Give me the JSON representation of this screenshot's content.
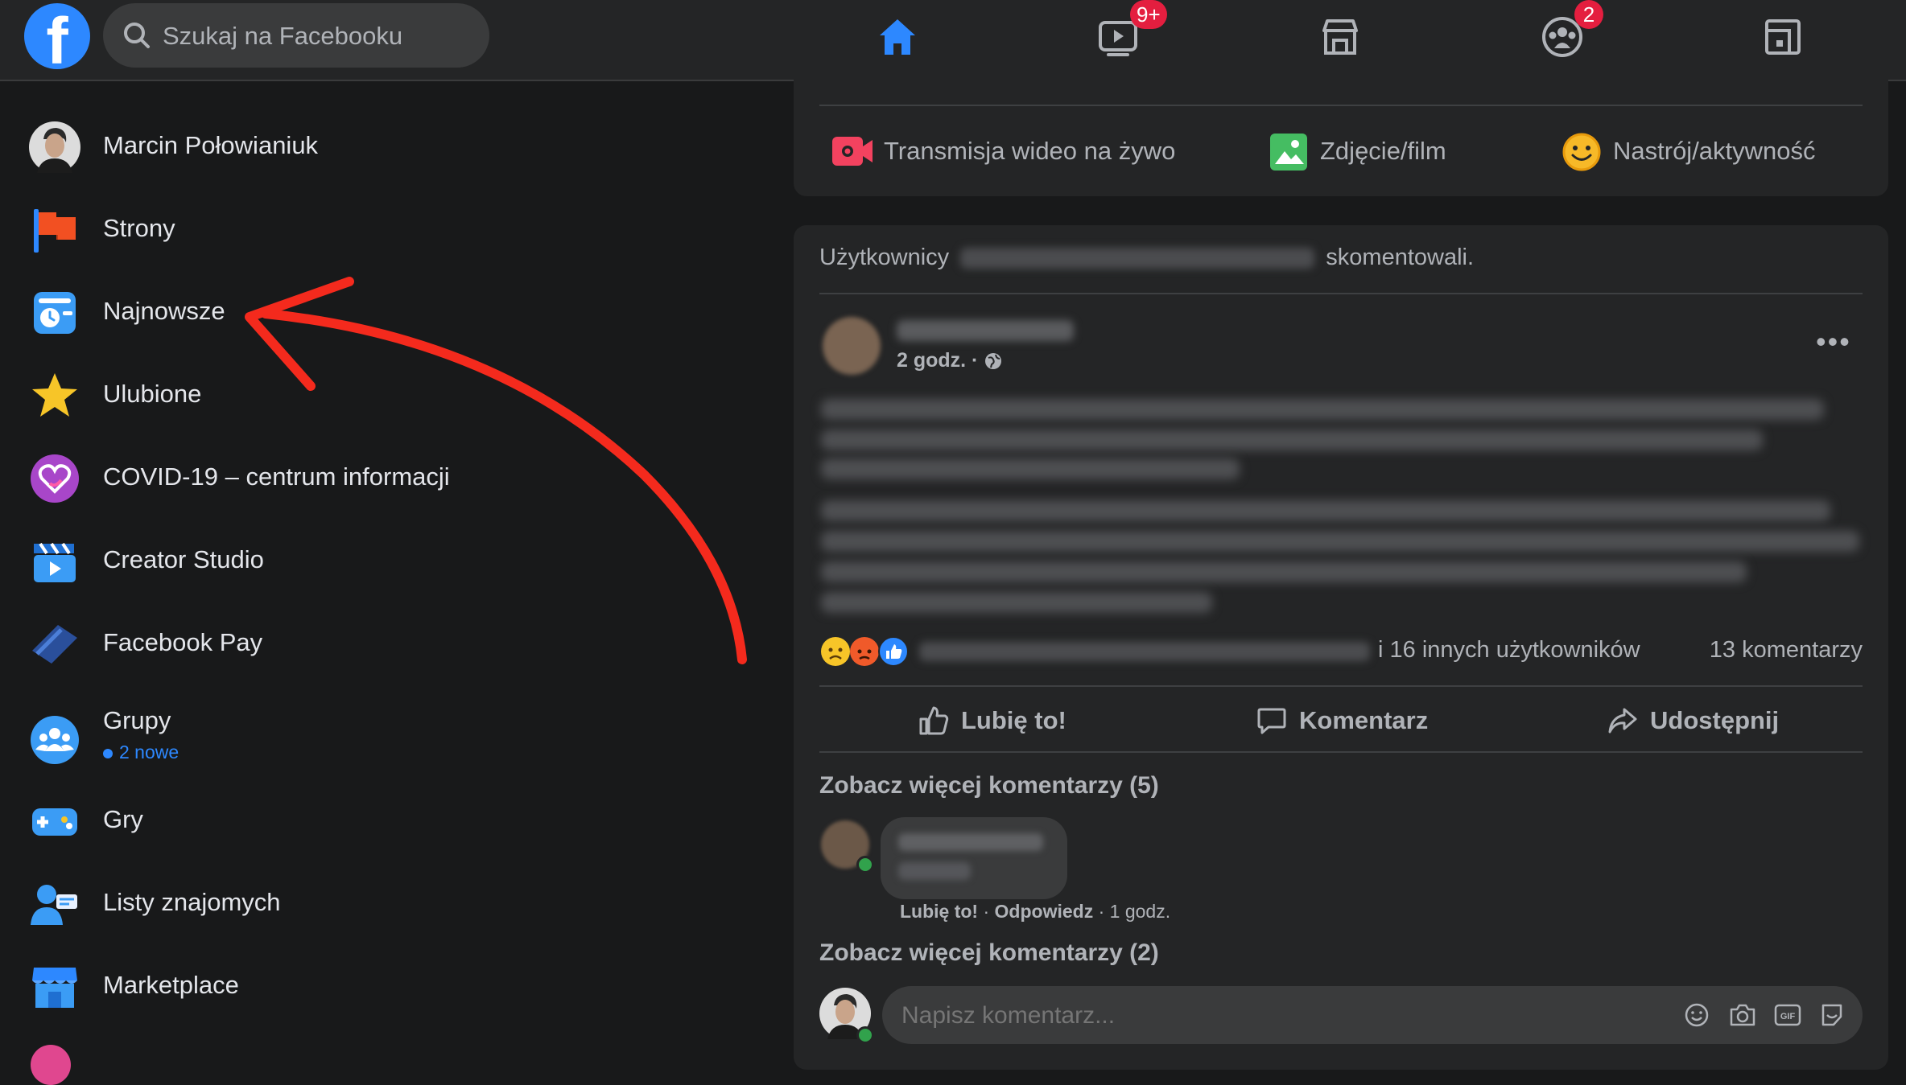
{
  "search": {
    "placeholder": "Szukaj na Facebooku"
  },
  "nav": {
    "home": {
      "icon": "home-icon"
    },
    "watch": {
      "icon": "video-icon",
      "badge": "9+"
    },
    "marketplace": {
      "icon": "marketplace-icon"
    },
    "groups": {
      "icon": "groups-icon",
      "badge": "2"
    },
    "gaming": {
      "icon": "gaming-icon"
    }
  },
  "sidebar": {
    "items": [
      {
        "label": "Marcin Połowianiuk",
        "icon": "avatar"
      },
      {
        "label": "Strony",
        "icon": "flag-icon"
      },
      {
        "label": "Najnowsze",
        "icon": "clock-feed-icon"
      },
      {
        "label": "Ulubione",
        "icon": "star-icon"
      },
      {
        "label": "COVID-19 – centrum informacji",
        "icon": "covid-heart-icon"
      },
      {
        "label": "Creator Studio",
        "icon": "clapper-icon"
      },
      {
        "label": "Facebook Pay",
        "icon": "pay-card-icon"
      },
      {
        "label": "Grupy",
        "icon": "groups-icon",
        "sub": "2 nowe"
      },
      {
        "label": "Gry",
        "icon": "gamepad-icon"
      },
      {
        "label": "Listy znajomych",
        "icon": "friends-list-icon"
      },
      {
        "label": "Marketplace",
        "icon": "shop-icon"
      }
    ]
  },
  "composer": {
    "live": "Transmisja wideo na żywo",
    "photo": "Zdjęcie/film",
    "feeling": "Nastrój/aktywność"
  },
  "post": {
    "header_prefix": "Użytkownicy",
    "header_suffix": "skomentowali.",
    "time": "2 godz. ·",
    "reactions_others": "i 16 innych użytkowników",
    "comments_count": "13 komentarzy",
    "like": "Lubię to!",
    "comment": "Komentarz",
    "share": "Udostępnij",
    "more_comments_1": "Zobacz więcej komentarzy (5)",
    "more_comments_2": "Zobacz więcej komentarzy (2)",
    "comment_like": "Lubię to!",
    "comment_reply": "Odpowiedz",
    "comment_time": "1 godz.",
    "comment_placeholder": "Napisz komentarz..."
  },
  "colors": {
    "accent": "#2d88ff",
    "annotation_arrow": "#f42a1d",
    "badge": "#e41e3f"
  }
}
